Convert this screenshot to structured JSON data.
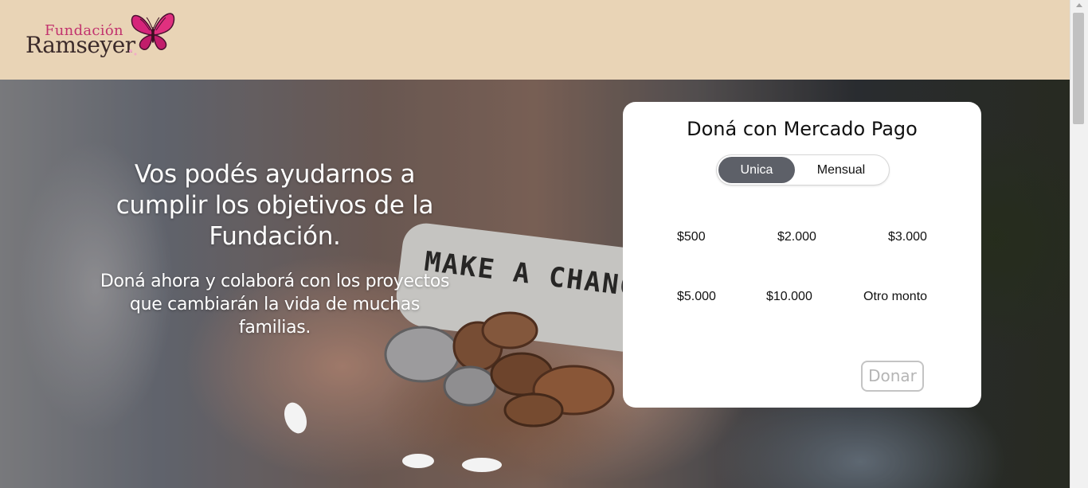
{
  "header": {
    "logo_line1": "Fundación",
    "logo_line2": "Ramseyer",
    "logo_icon": "butterfly-icon"
  },
  "hero": {
    "title": "Vos podés ayudarnos a cumplir los objetivos de la Fundación.",
    "subtitle": "Doná ahora y colaborá con los proyectos que cambiarán la vida de muchas familias.",
    "paper_text": "MAKE A CHANG"
  },
  "donation_card": {
    "title": "Doná con Mercado Pago",
    "toggle": {
      "options": [
        "Unica",
        "Mensual"
      ],
      "selected": "Unica"
    },
    "amounts": [
      "$500",
      "$2.000",
      "$3.000",
      "$5.000",
      "$10.000",
      "Otro monto"
    ],
    "donate_label": "Donar"
  },
  "colors": {
    "header_bg": "#e9d4b6",
    "toggle_active": "#5d6068",
    "logo_accent": "#c2336e"
  }
}
